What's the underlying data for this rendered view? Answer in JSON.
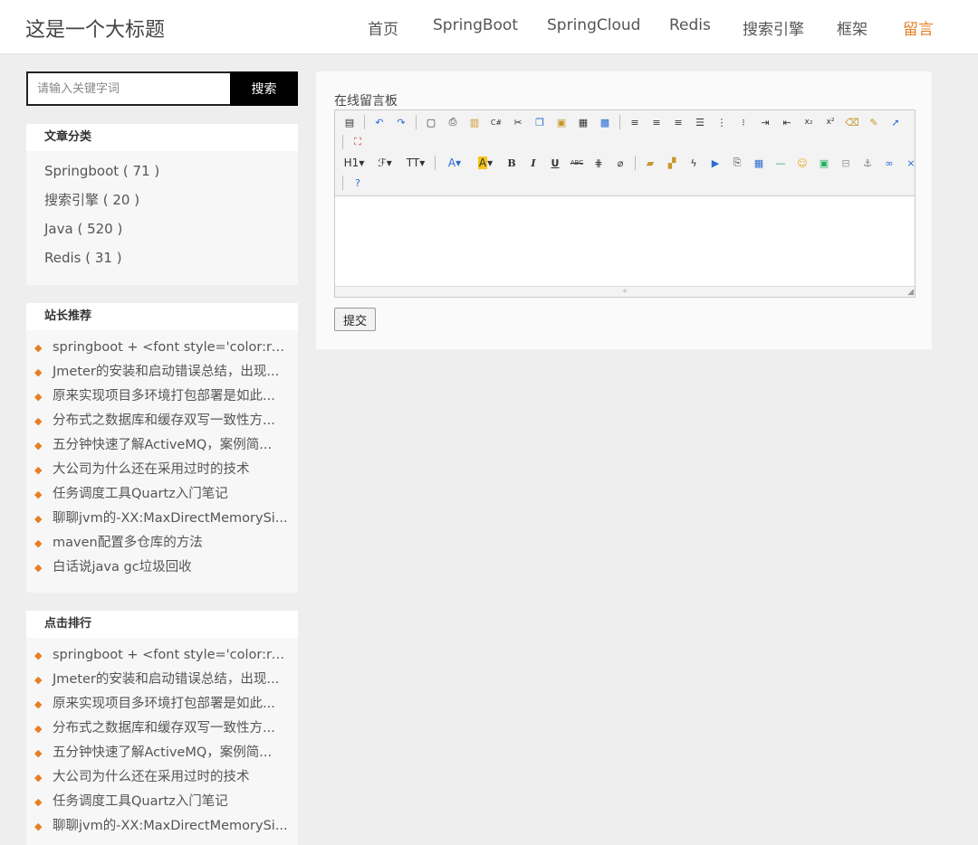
{
  "header": {
    "site_title": "这是一个大标题",
    "nav": [
      {
        "label": "首页",
        "active": false
      },
      {
        "label": "SpringBoot",
        "active": false
      },
      {
        "label": "SpringCloud",
        "active": false
      },
      {
        "label": "Redis",
        "active": false
      },
      {
        "label": "搜索引擎",
        "active": false
      },
      {
        "label": "框架",
        "active": false
      },
      {
        "label": "留言",
        "active": true
      }
    ],
    "accent_color": "#e67e22"
  },
  "search": {
    "placeholder": "请输入关键字词",
    "value": "",
    "button_label": "搜索"
  },
  "categories": {
    "title": "文章分类",
    "items": [
      {
        "label": "Springboot ( 71 )"
      },
      {
        "label": "搜索引擎 ( 20 )"
      },
      {
        "label": "Java ( 520 )"
      },
      {
        "label": "Redis ( 31 )"
      }
    ]
  },
  "recommend": {
    "title": "站长推荐",
    "items": [
      "springboot + <font style='color:re...",
      "Jmeter的安装和启动错误总结，出现...",
      "原来实现项目多环境打包部署是如此...",
      "分布式之数据库和缓存双写一致性方...",
      "五分钟快速了解ActiveMQ，案例简...",
      "大公司为什么还在采用过时的技术",
      "任务调度工具Quartz入门笔记",
      "聊聊jvm的-XX:MaxDirectMemorySi...",
      "maven配置多仓库的方法",
      "白话说java gc垃圾回收"
    ]
  },
  "ranking": {
    "title": "点击排行",
    "items": [
      "springboot + <font style='color:re...",
      "Jmeter的安装和启动错误总结，出现...",
      "原来实现项目多环境打包部署是如此...",
      "分布式之数据库和缓存双写一致性方...",
      "五分钟快速了解ActiveMQ，案例简...",
      "大公司为什么还在采用过时的技术",
      "任务调度工具Quartz入门笔记",
      "聊聊jvm的-XX:MaxDirectMemorySi..."
    ]
  },
  "message_board": {
    "label": "在线留言板",
    "content": "",
    "submit_label": "提交",
    "toolbar_row1": [
      "source-icon",
      "undo-icon",
      "redo-icon",
      "preview-icon",
      "print-icon",
      "template-icon",
      "code-icon",
      "cut-icon",
      "copy-icon",
      "paste-icon",
      "paste-text-icon",
      "paste-word-icon",
      "align-left-icon",
      "align-center-icon",
      "align-right-icon",
      "justify-icon",
      "ordered-list-icon",
      "unordered-list-icon",
      "indent-icon",
      "outdent-icon",
      "subscript-icon",
      "superscript-icon",
      "clear-format-icon",
      "select-all-icon",
      "pointer-icon"
    ],
    "toolbar_row1b": [
      "fullscreen-icon"
    ],
    "toolbar_row2": [
      "heading-icon",
      "font-family-icon",
      "font-size-icon",
      "font-color-icon",
      "highlight-icon",
      "bold-icon",
      "italic-icon",
      "underline-icon",
      "strikethrough-icon",
      "line-height-icon",
      "remove-format-icon",
      "image-icon",
      "multi-image-icon",
      "flash-icon",
      "media-icon",
      "attachment-icon",
      "table-icon",
      "hr-icon",
      "emoticon-icon",
      "map-icon",
      "pagebreak-icon",
      "anchor-icon",
      "link-icon",
      "unlink-icon"
    ],
    "toolbar_row2b": [
      "about-icon"
    ]
  }
}
